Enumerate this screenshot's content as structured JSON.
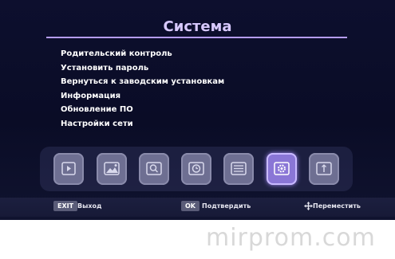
{
  "window": {
    "title": "Система"
  },
  "menu": {
    "items": [
      {
        "label": "Родительский контроль"
      },
      {
        "label": "Установить пароль"
      },
      {
        "label": "Вернуться к заводским установкам"
      },
      {
        "label": "Информация"
      },
      {
        "label": "Обновление ПО"
      },
      {
        "label": "Настройки сети"
      }
    ]
  },
  "icon_bar": {
    "tiles": [
      {
        "icon": "video-icon",
        "selected": false
      },
      {
        "icon": "image-icon",
        "selected": false
      },
      {
        "icon": "search-icon",
        "selected": false
      },
      {
        "icon": "clock-icon",
        "selected": false
      },
      {
        "icon": "list-icon",
        "selected": false
      },
      {
        "icon": "gear-icon",
        "selected": true
      },
      {
        "icon": "usb-icon",
        "selected": false
      }
    ]
  },
  "footer": {
    "exit_key": "EXIT",
    "exit_label": "Выход",
    "ok_key": "OK",
    "ok_label": "Подтвердить",
    "move_label": "Переместить",
    "move_icon": "four-arrows-icon"
  },
  "watermark": "mirprom.com",
  "colors": {
    "title": "#d8c9ff",
    "accent": "#b59cf2",
    "selected_tile": "#8a76d6",
    "tile": "#6e6f92"
  }
}
